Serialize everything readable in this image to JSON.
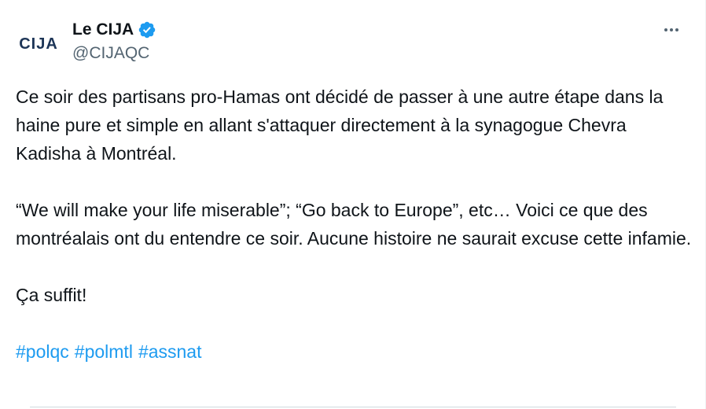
{
  "author": {
    "avatar_text": "CIJA",
    "display_name": "Le CIJA",
    "handle": "@CIJAQC",
    "verified": true
  },
  "tweet": {
    "paragraphs": [
      "Ce soir des partisans pro-Hamas ont décidé de passer à une autre étape dans la haine pure et simple en allant s'attaquer directement à la synagogue Chevra Kadisha à Montréal.",
      "“We will make your life miserable”; “Go back to Europe”, etc… Voici ce que des montréalais ont du entendre ce soir. Aucune histoire ne saurait excuse cette infamie.",
      "Ça suffit!"
    ],
    "hashtags": [
      "#polqc",
      "#polmtl",
      "#assnat"
    ]
  },
  "icons": {
    "verified": "verified-badge-icon",
    "more": "more-options-icon"
  },
  "colors": {
    "link": "#1d9bf0",
    "text": "#0f1419",
    "secondary": "#536471",
    "verified": "#1d9bf0"
  }
}
